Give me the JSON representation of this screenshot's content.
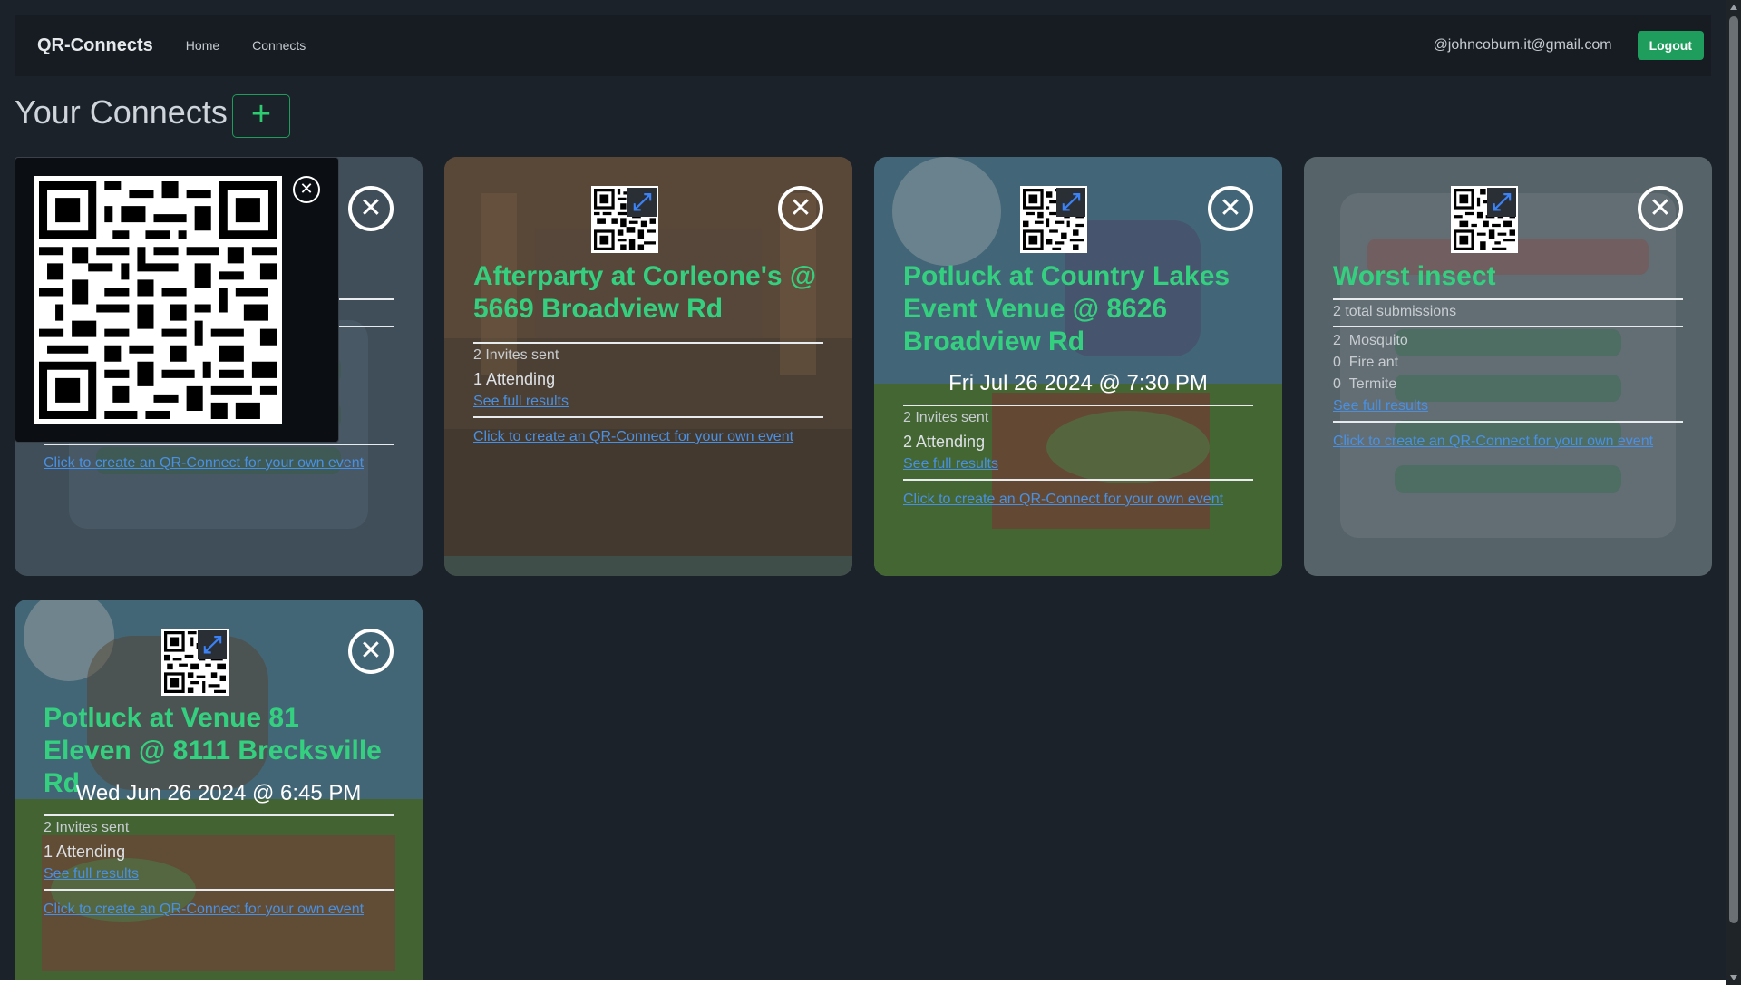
{
  "navbar": {
    "brand": "QR-Connects",
    "links": [
      "Home",
      "Connects"
    ],
    "user_email": "@johncoburn.it@gmail.com",
    "logout_label": "Logout"
  },
  "page": {
    "title": "Your Connects",
    "add_label": "+"
  },
  "cards": [
    {
      "hidden_behind_popup": true,
      "create_link": "Click to create an QR-Connect for your own event"
    },
    {
      "title": "Afterparty at Corleone's @ 5669 Broadview Rd",
      "invites": "2 Invites sent",
      "attending": "1 Attending",
      "results_link": "See full results",
      "create_link": "Click to create an QR-Connect for your own event"
    },
    {
      "title": "Potluck at Country Lakes Event Venue @ 8626 Broadview Rd",
      "date": "Fri Jul 26 2024 @ 7:30 PM",
      "invites": "2 Invites sent",
      "attending": "2 Attending",
      "results_link": "See full results",
      "create_link": "Click to create an QR-Connect for your own event"
    },
    {
      "title": "Worst insect",
      "total": "2 total submissions",
      "options": [
        {
          "count": "2",
          "label": "Mosquito"
        },
        {
          "count": "0",
          "label": "Fire ant"
        },
        {
          "count": "0",
          "label": "Termite"
        }
      ],
      "results_link": "See full results",
      "create_link": "Click to create an QR-Connect for your own event"
    },
    {
      "title": "Potluck at Venue 81 Eleven @ 8111 Brecksville Rd",
      "date": "Wed Jun 26 2024 @ 6:45 PM",
      "invites": "2 Invites sent",
      "attending": "1 Attending",
      "results_link": "See full results",
      "create_link": "Click to create an QR-Connect for your own event"
    }
  ],
  "icons": {
    "close": "close-icon",
    "expand": "expand-icon",
    "add": "plus-icon"
  },
  "colors": {
    "accent": "#1f9d5c",
    "title_green": "#35d07f",
    "link_blue": "#4a90e2",
    "background": "#1b222a"
  }
}
